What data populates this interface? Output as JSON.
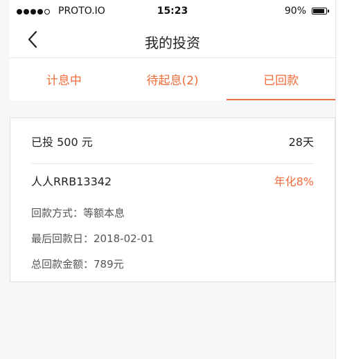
{
  "status_bar": {
    "carrier": "PROTO.IO",
    "time": "15:23",
    "battery_percent": "90%",
    "battery_level": 0.9
  },
  "nav": {
    "title": "我的投资",
    "back_icon": "chevron-left-icon"
  },
  "tabs": [
    {
      "label": "计息中",
      "active": false
    },
    {
      "label": "待起息(2)",
      "active": false
    },
    {
      "label": "已回款",
      "active": true
    }
  ],
  "investment": {
    "amount": "已投 500 元",
    "duration": "28天",
    "product": "人人RRB13342",
    "annual_rate": "年化8%",
    "repayment_method": "回款方式：等额本息",
    "final_repayment_date": "最后回款日：2018-02-01",
    "total_repayment": "总回款金额：789元"
  },
  "colors": {
    "accent": "#f26b3a",
    "background": "#f7f7f7"
  }
}
